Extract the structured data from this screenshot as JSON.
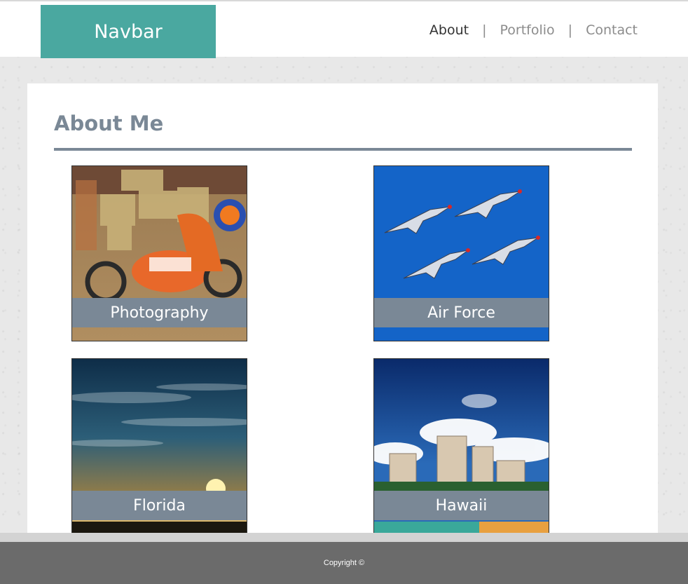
{
  "navbar": {
    "brand": "Navbar",
    "items": [
      {
        "label": "About",
        "active": true
      },
      {
        "label": "Portfolio",
        "active": false
      },
      {
        "label": "Contact",
        "active": false
      }
    ],
    "separator": "|"
  },
  "main": {
    "title": "About Me",
    "tiles": [
      {
        "caption": "Photography"
      },
      {
        "caption": "Air Force"
      },
      {
        "caption": "Florida"
      },
      {
        "caption": "Hawaii"
      }
    ]
  },
  "footer": {
    "copyright": "Copyright ©"
  },
  "colors": {
    "brand_bg": "#4aa8a0",
    "accent_slate": "#7a8896",
    "footer_bg": "#6b6b6b"
  }
}
